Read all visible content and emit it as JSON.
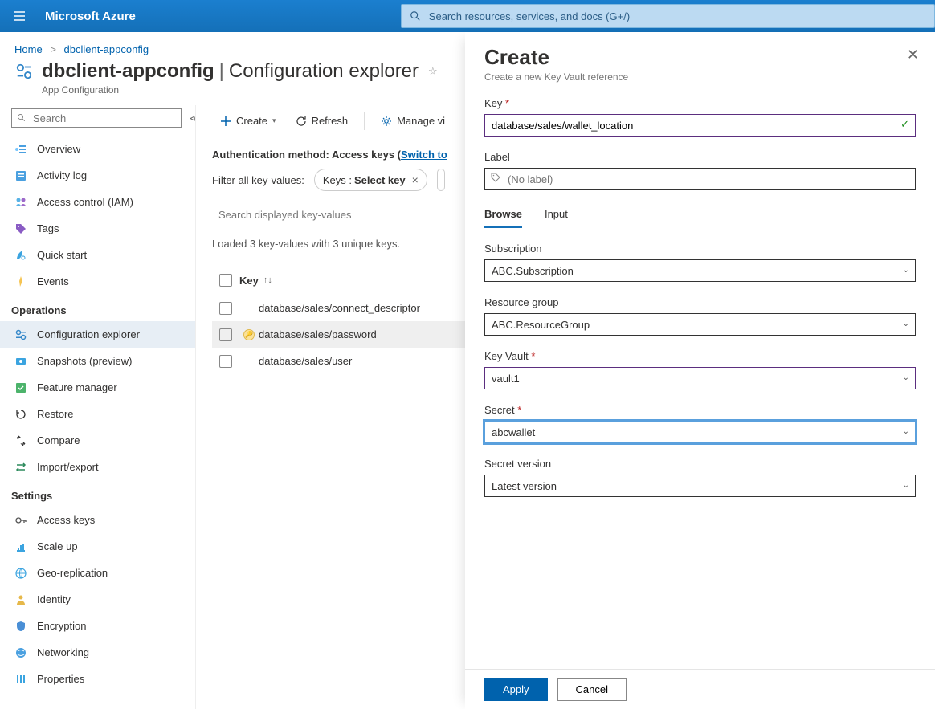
{
  "brand": "Microsoft Azure",
  "global_search_placeholder": "Search resources, services, and docs (G+/)",
  "breadcrumbs": {
    "home": "Home",
    "current": "dbclient-appconfig"
  },
  "page": {
    "resource_name": "dbclient-appconfig",
    "section": "Configuration explorer",
    "service": "App Configuration"
  },
  "sidebar": {
    "search_placeholder": "Search",
    "top": [
      {
        "label": "Overview",
        "icon": "overview"
      },
      {
        "label": "Activity log",
        "icon": "log"
      },
      {
        "label": "Access control (IAM)",
        "icon": "iam"
      },
      {
        "label": "Tags",
        "icon": "tags"
      },
      {
        "label": "Quick start",
        "icon": "quickstart"
      },
      {
        "label": "Events",
        "icon": "events"
      }
    ],
    "operations_title": "Operations",
    "operations": [
      {
        "label": "Configuration explorer",
        "icon": "config",
        "selected": true
      },
      {
        "label": "Snapshots (preview)",
        "icon": "snapshots"
      },
      {
        "label": "Feature manager",
        "icon": "feature"
      },
      {
        "label": "Restore",
        "icon": "restore"
      },
      {
        "label": "Compare",
        "icon": "compare"
      },
      {
        "label": "Import/export",
        "icon": "import"
      }
    ],
    "settings_title": "Settings",
    "settings": [
      {
        "label": "Access keys",
        "icon": "accesskeys"
      },
      {
        "label": "Scale up",
        "icon": "scale"
      },
      {
        "label": "Geo-replication",
        "icon": "geo"
      },
      {
        "label": "Identity",
        "icon": "identity"
      },
      {
        "label": "Encryption",
        "icon": "encryption"
      },
      {
        "label": "Networking",
        "icon": "networking"
      },
      {
        "label": "Properties",
        "icon": "properties"
      }
    ]
  },
  "toolbar": {
    "create": "Create",
    "refresh": "Refresh",
    "manage": "Manage vi"
  },
  "auth_line": {
    "prefix": "Authentication method: Access keys (",
    "link": "Switch to",
    "suffix": ""
  },
  "filter": {
    "label": "Filter all key-values:",
    "pill_prefix": "Keys :",
    "pill_value": "Select key"
  },
  "kv_search_placeholder": "Search displayed key-values",
  "loaded_line": "Loaded 3 key-values with 3 unique keys.",
  "table": {
    "key_header": "Key",
    "rows": [
      {
        "key": "database/sales/connect_descriptor",
        "kv": false
      },
      {
        "key": "database/sales/password",
        "kv": true,
        "selected": true
      },
      {
        "key": "database/sales/user",
        "kv": false
      }
    ]
  },
  "panel": {
    "title": "Create",
    "subtitle": "Create a new Key Vault reference",
    "key_label": "Key",
    "key_value": "database/sales/wallet_location",
    "label_label": "Label",
    "label_placeholder": "(No label)",
    "tabs": {
      "browse": "Browse",
      "input": "Input"
    },
    "subscription_label": "Subscription",
    "subscription_value": "ABC.Subscription",
    "rg_label": "Resource group",
    "rg_value": "ABC.ResourceGroup",
    "kv_label": "Key Vault",
    "kv_value": "vault1",
    "secret_label": "Secret",
    "secret_value": "abcwallet",
    "version_label": "Secret version",
    "version_value": "Latest version",
    "apply": "Apply",
    "cancel": "Cancel"
  }
}
